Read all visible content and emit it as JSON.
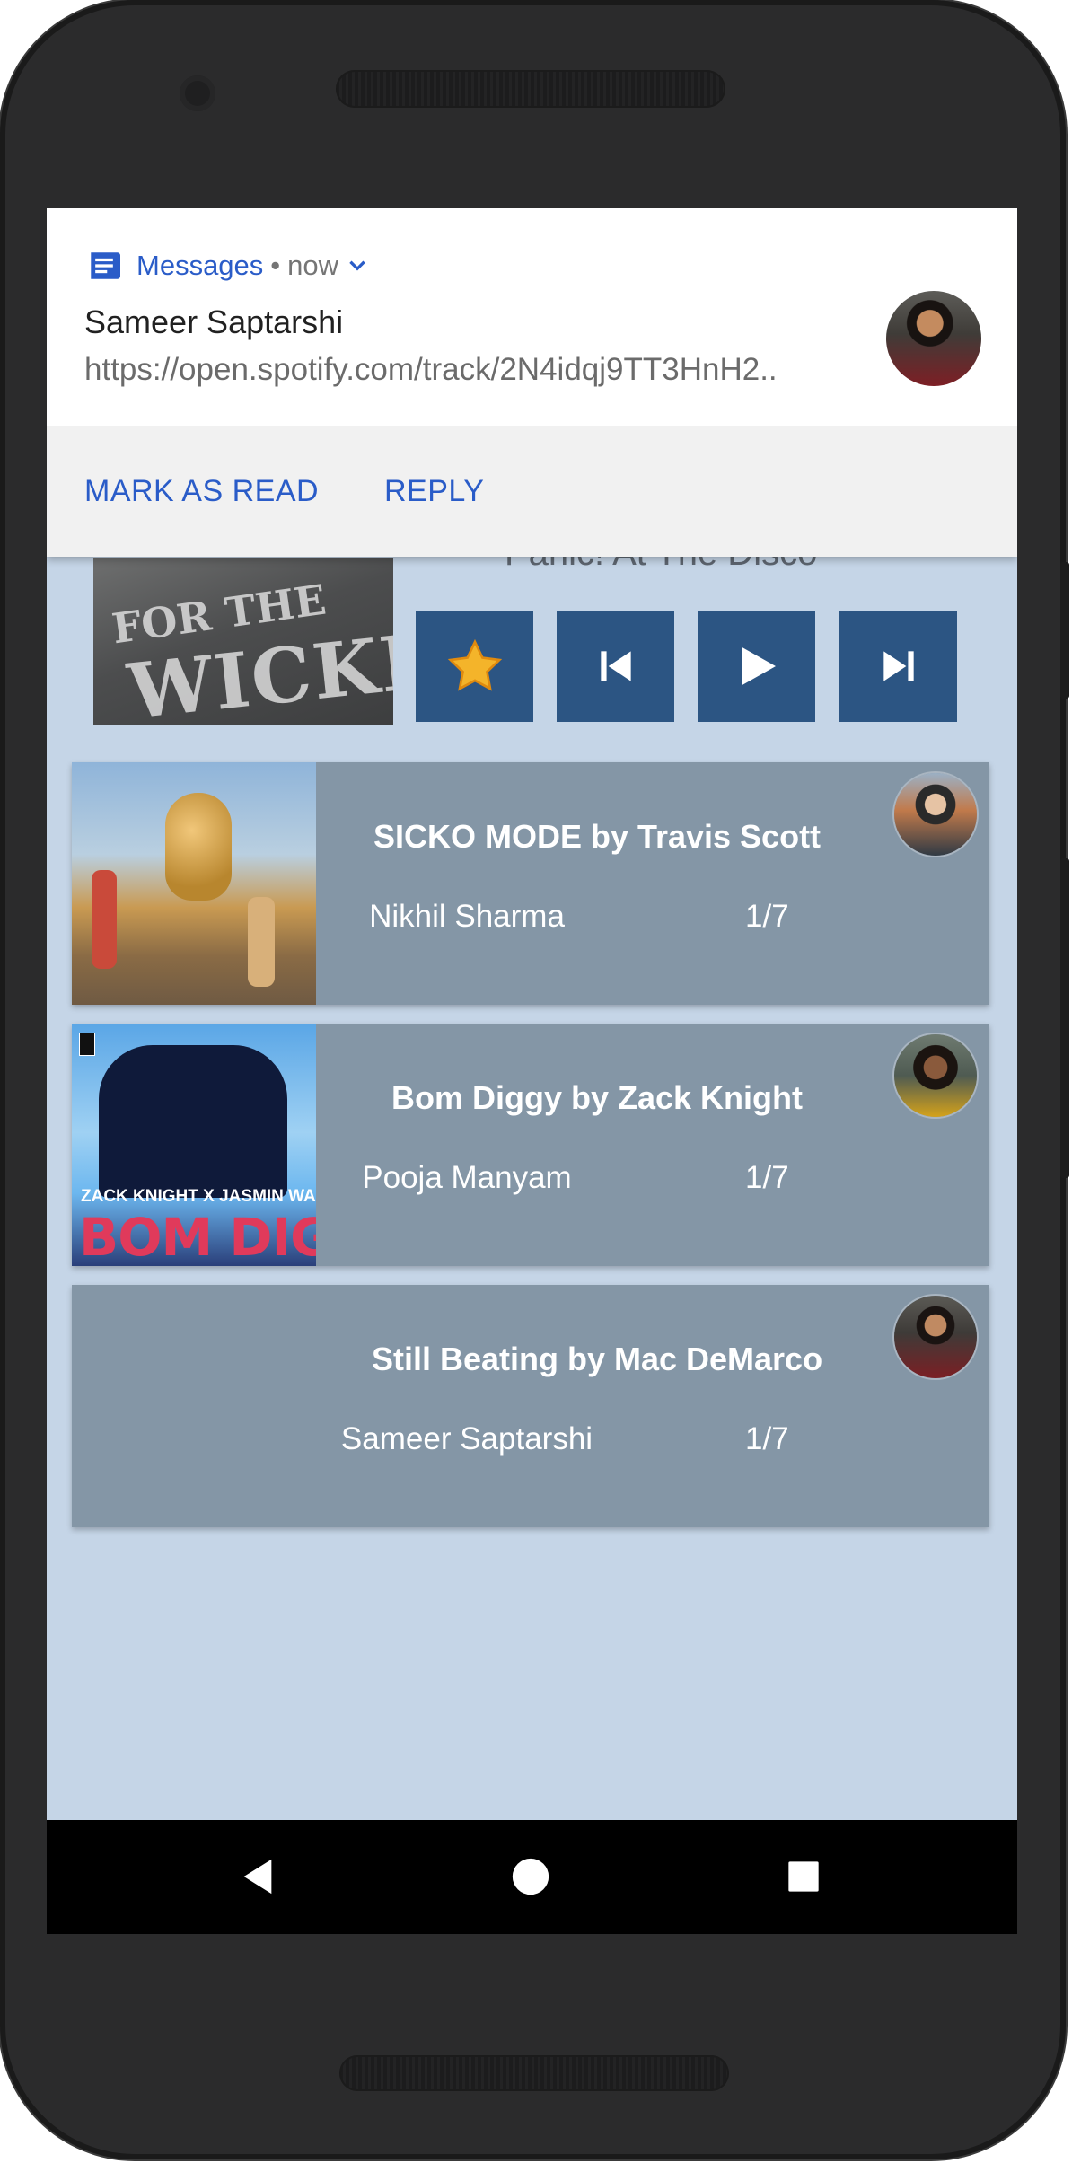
{
  "notification": {
    "app_name": "Messages",
    "separator": "•",
    "time": "now",
    "sender": "Sameer Saptarshi",
    "message": "https://open.spotify.com/track/2N4idqj9TT3HnH2..",
    "actions": {
      "mark_read": "MARK AS READ",
      "reply": "REPLY"
    }
  },
  "now_playing": {
    "artist": "Panic! At The Disco",
    "album_art_text": [
      "FOR THE",
      "WICKED"
    ],
    "controls": [
      "star-icon",
      "skip-previous-icon",
      "play-icon",
      "skip-next-icon"
    ]
  },
  "shared_tracks": [
    {
      "title": "SICKO MODE by Travis Scott",
      "shared_by": "Nikhil Sharma",
      "count": "1/7"
    },
    {
      "title": "Bom Diggy by Zack Knight",
      "shared_by": "Pooja Manyam",
      "count": "1/7",
      "art_text_top": "ZACK KNIGHT X JASMIN WALIA",
      "art_text_main": "BOM DIGGY"
    },
    {
      "title": "Still Beating by Mac DeMarco",
      "shared_by": "Sameer Saptarshi",
      "count": "1/7"
    }
  ],
  "colors": {
    "background": "#c5d5e7",
    "card": "#8496a6",
    "control": "#2c5583",
    "accent": "#2a5cc8"
  }
}
